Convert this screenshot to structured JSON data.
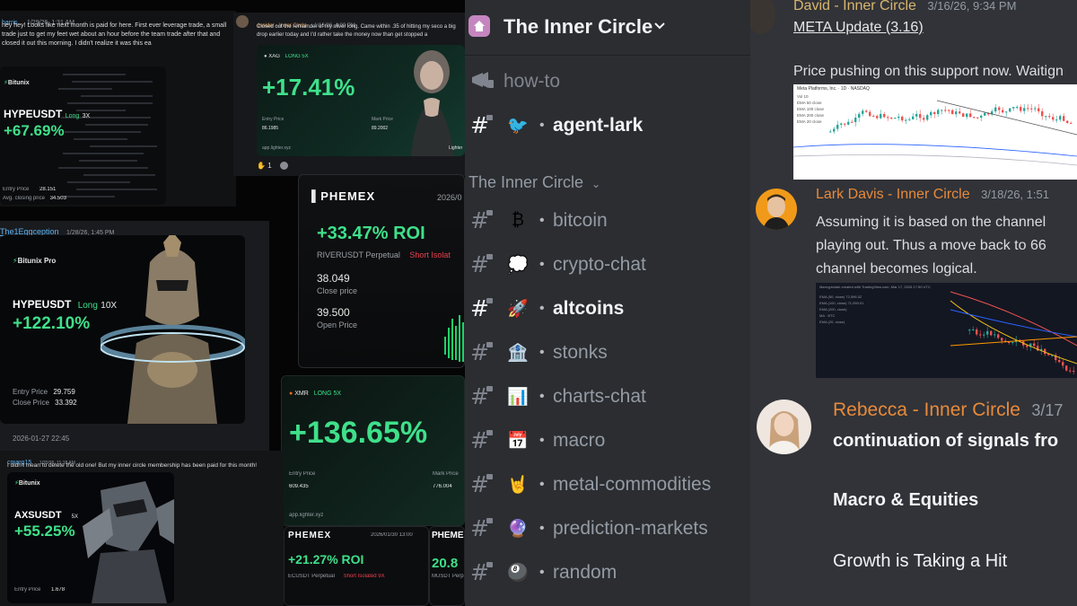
{
  "left": {
    "harris_post": {
      "name": "harris",
      "time": "1/29/26, 1:31 AM",
      "text": "hey hey! Looks like next month is paid for here. First ever leverage trade, a small trade just to get my feet wet about an hour before the team trade after that and closed it out this morning. I didn't realize it was this ea",
      "exchange": "Bitunix",
      "pair": "HYPEUSDT",
      "side": "Long",
      "lev": "3X",
      "pnl": "+67.69%",
      "entry_label": "Entry Price",
      "entry": "28.151",
      "avg_label": "Avg. closing price",
      "avg": "34.503"
    },
    "dsnider_post": {
      "name": "dsnider - Inner Circle",
      "time": "1/16/26, 4:00 PM",
      "text": "Closed out the remainder of my silver long. Came within .35 of hitting my seco a big drop earlier today and I'd rather take the money now than get stopped a",
      "asset": "XAG",
      "tag": "LONG 5X",
      "pnl": "+17.41%",
      "entry_label": "Entry Price",
      "entry": "86.1985",
      "mark_label": "Mark Price",
      "mark": "89.2002",
      "site": "app.lighter.xyz",
      "brand": "Lighter",
      "reaction1": "✋",
      "reaction1_count": "1"
    },
    "phemex_card": {
      "brand": "PHEMEX",
      "date": "2026/0",
      "roi": "+33.47% ROI",
      "pair": "RIVERUSDT Perpetual",
      "side": "Short Isolat",
      "close_val": "38.049",
      "close_label": "Close price",
      "open_val": "39.500",
      "open_label": "Open Price"
    },
    "eggception_post": {
      "name": "The1Eggception",
      "time": "1/28/26, 1:45 PM",
      "exchange": "Bitunix Pro",
      "pair": "HYPEUSDT",
      "side": "Long",
      "lev": "10X",
      "pnl": "+122.10%",
      "entry_label": "Entry Price",
      "entry": "29.759",
      "close_label": "Close Price",
      "close": "33.392",
      "date": "2026-01-27 22:45"
    },
    "xmr_card": {
      "asset": "XMR",
      "tag": "LONG 5X",
      "pnl": "+136.65%",
      "entry_label": "Entry Price",
      "entry": "609.435",
      "mark_label": "Mark Price",
      "mark": "776.004",
      "site": "app.lighter.xyz"
    },
    "cmarg_post": {
      "name": "cmarg15",
      "time": "1/20/26, 11:18 AM",
      "text": "I didn't mean to delete the old one! But my inner circle membership has been paid for this month!",
      "exchange": "Bitunix",
      "pair": "AXSUSDT",
      "lev": "5X",
      "pnl": "+55.25%",
      "entry_label": "Entry Price",
      "entry": "1.678"
    },
    "phemex2": {
      "brand": "PHEMEX",
      "date": "2026/01/30 13:00",
      "roi": "+21.27% ROI",
      "pair": "ECUSDT Perpetual",
      "side": "Short Isolated 9X"
    },
    "phemex3": {
      "brand": "PHEME",
      "pnl": "20.8",
      "pair": "MUSDT Perp"
    }
  },
  "sidebar": {
    "server_name": "The Inner Circle",
    "category": "The Inner Circle",
    "top_channels": [
      {
        "name": "how-to",
        "emoji": "📢",
        "bold": false
      },
      {
        "name": "agent-lark",
        "emoji": "🐦",
        "bold": true
      }
    ],
    "channels": [
      {
        "name": "bitcoin",
        "emoji": "₿",
        "bold": false
      },
      {
        "name": "crypto-chat",
        "emoji": "💭",
        "bold": false
      },
      {
        "name": "altcoins",
        "emoji": "🚀",
        "bold": true
      },
      {
        "name": "stonks",
        "emoji": "🏦",
        "bold": false
      },
      {
        "name": "charts-chat",
        "emoji": "📊",
        "bold": false
      },
      {
        "name": "macro",
        "emoji": "📅",
        "bold": false
      },
      {
        "name": "metal-commodities",
        "emoji": "🤘",
        "bold": false
      },
      {
        "name": "prediction-markets",
        "emoji": "🔮",
        "bold": false
      },
      {
        "name": "random",
        "emoji": "🎱",
        "bold": false
      }
    ]
  },
  "chat": {
    "m1": {
      "name": "David - Inner Circle",
      "time": "3/16/26, 9:34 PM",
      "link": "META Update (3.16)",
      "text": "Price pushing on this support now. Waitign",
      "chart_title": "Meta Platforms, Inc. · 1D · NASDAQ",
      "legend": [
        "Vol 10",
        "EMA 50 close",
        "EMA 100 close",
        "EMA 200 close",
        "EMA 20 close"
      ]
    },
    "m2": {
      "name": "Lark Davis - Inner Circle",
      "time": "3/18/26, 1:51",
      "text1": "Assuming it is based on the channel",
      "text2": "playing out. Thus a move back to 66",
      "text3": "channel becomes logical.",
      "chart_title": "likecryptolark created with TradingView.com, Mar 17, 2026 17:50 UTC",
      "legend": [
        "EMA (50, close) 72,596.02",
        "EMA (100, close) 71,050.01",
        "EMA (200, close)",
        "MA · BTC",
        "EMA (20, close)"
      ]
    },
    "m3": {
      "name": "Rebecca - Inner Circle",
      "time": "3/17",
      "line1": "continuation of signals fro",
      "line2": "Macro & Equities",
      "line3": "Growth is Taking a Hit"
    }
  },
  "colors": {
    "pnl_green": "#3fe08a",
    "sidebar_bg": "#2b2d31",
    "chat_bg": "#313338",
    "david": "#d9b56e",
    "lark": "#e88a3a",
    "rebecca": "#e88a3a",
    "phemex_red": "#e8414f"
  }
}
